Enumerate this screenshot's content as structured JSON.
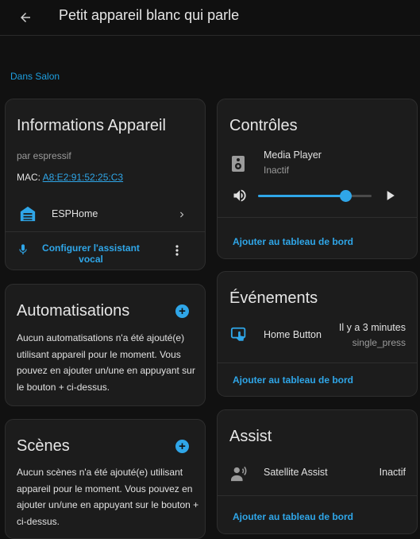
{
  "header": {
    "title": "Petit appareil blanc qui parle",
    "back_icon": "arrow-left-icon"
  },
  "breadcrumb": {
    "label": "Dans Salon"
  },
  "device_info": {
    "title": "Informations Appareil",
    "manufacturer": "par espressif",
    "mac_label": "MAC:",
    "mac_value": "A8:E2:91:52:25:C3",
    "integration": "ESPHome",
    "assistant_label": "Configurer l'assistant vocal"
  },
  "automations": {
    "title": "Automatisations",
    "text": "Aucun automatisations n'a été ajouté(e) utilisant appareil pour le moment. Vous pouvez en ajouter un/une en appuyant sur le bouton + ci-dessus."
  },
  "scenes": {
    "title": "Scènes",
    "text": "Aucun scènes n'a été ajouté(e) utilisant appareil pour le moment. Vous pouvez en ajouter un/une en appuyant sur le bouton + ci-dessus."
  },
  "controls": {
    "title": "Contrôles",
    "entity_name": "Media Player",
    "entity_state": "Inactif",
    "volume": 0.77,
    "add_link": "Ajouter au tableau de bord"
  },
  "events": {
    "title": "Événements",
    "entity_name": "Home Button",
    "time": "Il y a 3 minutes",
    "event_type": "single_press",
    "add_link": "Ajouter au tableau de bord"
  },
  "assist": {
    "title": "Assist",
    "entity_name": "Satellite Assist",
    "state": "Inactif",
    "add_link": "Ajouter au tableau de bord"
  },
  "colors": {
    "accent": "#2fa6e8",
    "background": "#111111",
    "card": "#1c1c1c"
  }
}
